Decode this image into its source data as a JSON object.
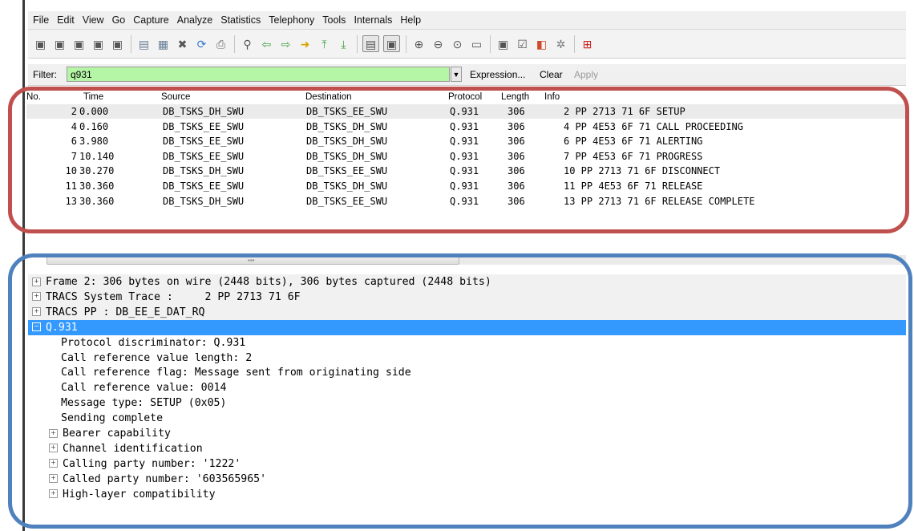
{
  "colors": {
    "filter_bg": "#b5f5a6",
    "selection": "#3399ff",
    "red_highlight": "#c0504d",
    "blue_highlight": "#4f81bd"
  },
  "menu": [
    "File",
    "Edit",
    "View",
    "Go",
    "Capture",
    "Analyze",
    "Statistics",
    "Telephony",
    "Tools",
    "Internals",
    "Help"
  ],
  "filter": {
    "label": "Filter:",
    "value": "q931",
    "expression": "Expression...",
    "clear": "Clear",
    "apply": "Apply"
  },
  "packet_list": {
    "columns": [
      "No.",
      "Time",
      "Source",
      "Destination",
      "Protocol",
      "Length",
      "Info"
    ],
    "rows": [
      {
        "no": "2",
        "time": "0.000",
        "src": "DB_TSKS_DH_SWU",
        "dst": "DB_TSKS_EE_SWU",
        "proto": "Q.931",
        "len": "306",
        "info": "2 PP 2713 71 6F SETUP"
      },
      {
        "no": "4",
        "time": "0.160",
        "src": "DB_TSKS_EE_SWU",
        "dst": "DB_TSKS_DH_SWU",
        "proto": "Q.931",
        "len": "306",
        "info": "4 PP 4E53 6F 71 CALL PROCEEDING"
      },
      {
        "no": "6",
        "time": "3.980",
        "src": "DB_TSKS_EE_SWU",
        "dst": "DB_TSKS_DH_SWU",
        "proto": "Q.931",
        "len": "306",
        "info": "6 PP 4E53 6F 71 ALERTING"
      },
      {
        "no": "7",
        "time": "10.140",
        "src": "DB_TSKS_EE_SWU",
        "dst": "DB_TSKS_DH_SWU",
        "proto": "Q.931",
        "len": "306",
        "info": "7 PP 4E53 6F 71 PROGRESS"
      },
      {
        "no": "10",
        "time": "30.270",
        "src": "DB_TSKS_DH_SWU",
        "dst": "DB_TSKS_EE_SWU",
        "proto": "Q.931",
        "len": "306",
        "info": "10 PP 2713 71 6F DISCONNECT"
      },
      {
        "no": "11",
        "time": "30.360",
        "src": "DB_TSKS_EE_SWU",
        "dst": "DB_TSKS_DH_SWU",
        "proto": "Q.931",
        "len": "306",
        "info": "11 PP 4E53 6F 71 RELEASE"
      },
      {
        "no": "13",
        "time": "30.360",
        "src": "DB_TSKS_DH_SWU",
        "dst": "DB_TSKS_EE_SWU",
        "proto": "Q.931",
        "len": "306",
        "info": "13 PP 2713 71 6F RELEASE COMPLETE"
      }
    ]
  },
  "details": {
    "top_nodes": [
      "Frame 2: 306 bytes on wire (2448 bits), 306 bytes captured (2448 bits)",
      "TRACS System Trace :     2 PP 2713 71 6F",
      "TRACS PP : DB_EE_E_DAT_RQ"
    ],
    "selected_node": "Q.931",
    "fields": [
      "Protocol discriminator: Q.931",
      "Call reference value length: 2",
      "Call reference flag: Message sent from originating side",
      "Call reference value: 0014",
      "Message type: SETUP (0x05)",
      "Sending complete"
    ],
    "subtrees": [
      "Bearer capability",
      "Channel identification",
      "Calling party number: '1222'",
      "Called party number: '603565965'",
      "High-layer compatibility"
    ]
  },
  "icons": {
    "toolbar": [
      "interface-list-icon",
      "capture-options-icon",
      "start-capture-icon",
      "stop-capture-icon",
      "restart-capture-icon",
      "open-file-icon",
      "save-file-icon",
      "close-file-icon",
      "reload-icon",
      "print-icon",
      "find-packet-icon",
      "go-back-icon",
      "go-forward-icon",
      "go-to-packet-icon",
      "go-first-icon",
      "go-last-icon",
      "colorize-icon",
      "autoscroll-icon",
      "zoom-in-icon",
      "zoom-out-icon",
      "zoom-normal-icon",
      "resize-columns-icon",
      "capture-filters-icon",
      "display-filters-icon",
      "coloring-rules-icon",
      "preferences-icon",
      "help-icon"
    ]
  }
}
